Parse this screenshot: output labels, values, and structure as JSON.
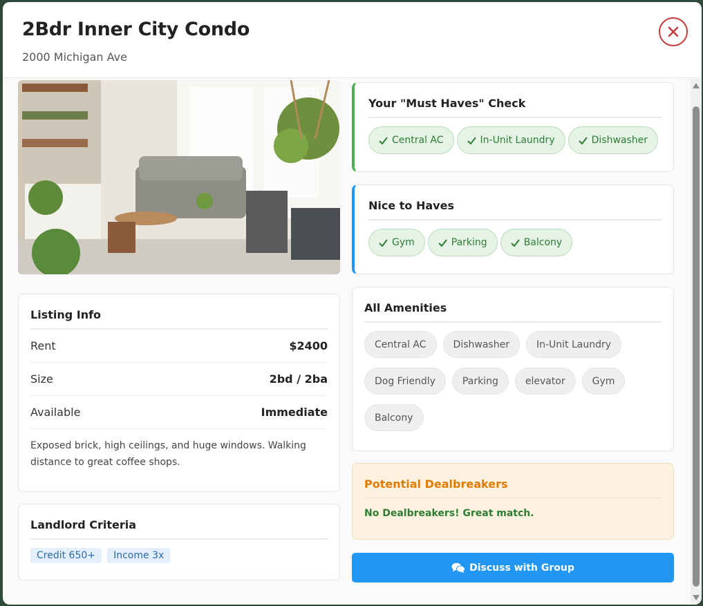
{
  "header": {
    "title": "2Bdr Inner City Condo",
    "address": "2000 Michigan Ave",
    "close_icon": "close-icon"
  },
  "listing_info": {
    "title": "Listing Info",
    "rows": [
      {
        "label": "Rent",
        "value": "$2400"
      },
      {
        "label": "Size",
        "value": "2bd / 2ba"
      },
      {
        "label": "Available",
        "value": "Immediate"
      }
    ],
    "description": "Exposed brick, high ceilings, and huge windows. Walking distance to great coffee shops."
  },
  "landlord": {
    "title": "Landlord Criteria",
    "criteria": [
      "Credit 650+",
      "Income 3x"
    ]
  },
  "must_haves": {
    "title": "Your \"Must Haves\" Check",
    "items": [
      "Central AC",
      "In-Unit Laundry",
      "Dishwasher"
    ],
    "accent": "#4caf50"
  },
  "nice_to_haves": {
    "title": "Nice to Haves",
    "items": [
      "Gym",
      "Parking",
      "Balcony"
    ],
    "accent": "#2196f3"
  },
  "amenities": {
    "title": "All Amenities",
    "items": [
      "Central AC",
      "Dishwasher",
      "In-Unit Laundry",
      "Dog Friendly",
      "Parking",
      "elevator",
      "Gym",
      "Balcony"
    ]
  },
  "dealbreakers": {
    "title": "Potential Dealbreakers",
    "message": "No Dealbreakers! Great match."
  },
  "actions": {
    "discuss_label": "Discuss with Group",
    "discuss_icon": "comments-icon"
  },
  "colors": {
    "primary": "#2196f3",
    "success": "#2e7d32",
    "warning": "#e07b00",
    "danger": "#c43b3b"
  }
}
